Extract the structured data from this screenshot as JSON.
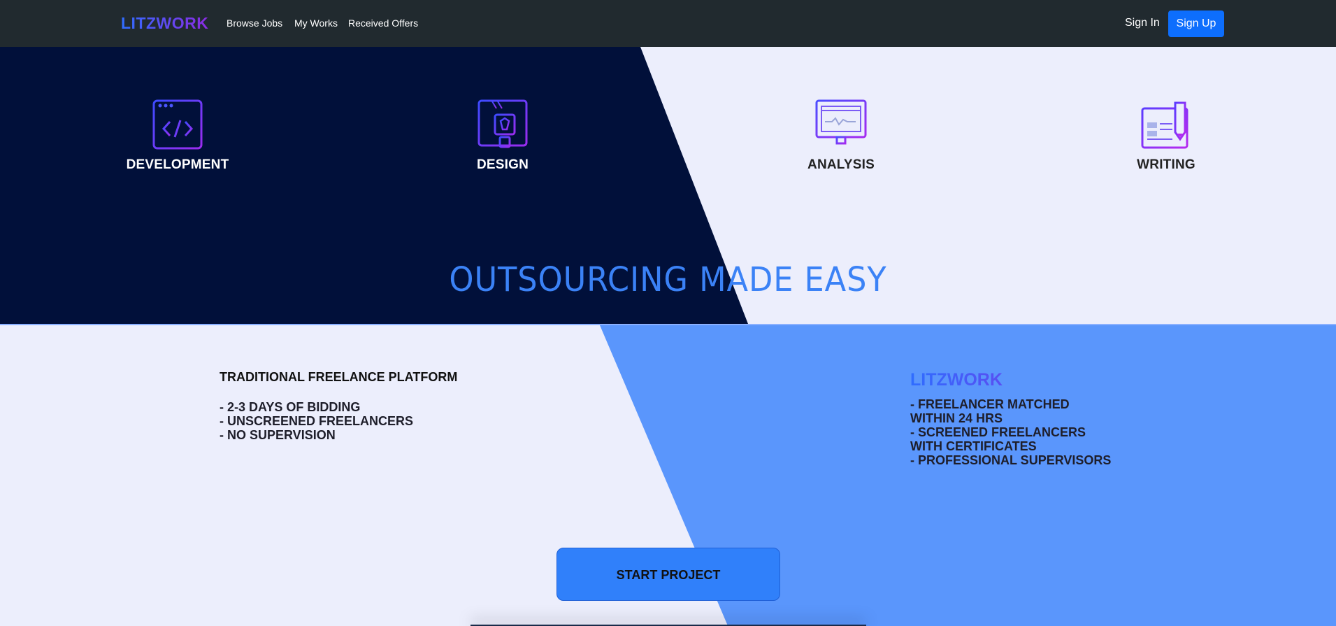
{
  "navbar": {
    "brand": "LITZWORK",
    "links": [
      "Browse Jobs",
      "My Works",
      "Received Offers"
    ],
    "signin": "Sign In",
    "signup": "Sign Up"
  },
  "categories": [
    {
      "label": "DEVELOPMENT",
      "icon": "code-window-icon"
    },
    {
      "label": "DESIGN",
      "icon": "pen-tool-icon"
    },
    {
      "label": "ANALYSIS",
      "icon": "monitor-chart-icon"
    },
    {
      "label": "WRITING",
      "icon": "document-pen-icon"
    }
  ],
  "hero": {
    "title": "OUTSOURCING MADE EASY"
  },
  "compare": {
    "left": {
      "title": "TRADITIONAL FREELANCE PLATFORM",
      "features": [
        "- 2-3 DAYS OF BIDDING",
        "- UNSCREENED FREELANCERS",
        "- NO SUPERVISION"
      ]
    },
    "right": {
      "title": "LITZWORK",
      "features": [
        "- FREELANCER MATCHED",
        "WITHIN 24 HRS",
        "- SCREENED FREELANCERS",
        "WITH CERTIFICATES",
        "- PROFESSIONAL SUPERVISORS"
      ]
    },
    "cta": "START PROJECT"
  },
  "colors": {
    "navbar_bg": "#212a2f",
    "hero_dark": "#01103a",
    "light_bg": "#eceefc",
    "accent_blue": "#3b82f6",
    "panel_blue": "#5a96fc",
    "signup_bg": "#0d6efd"
  }
}
